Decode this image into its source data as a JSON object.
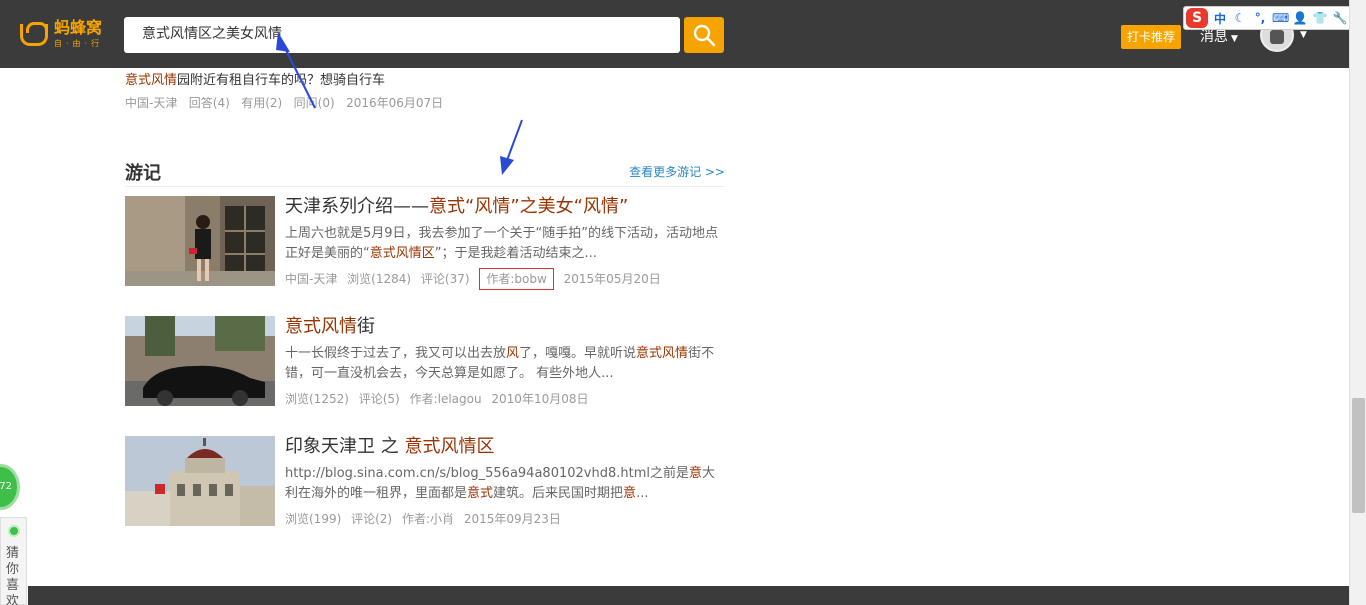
{
  "header": {
    "logo_text": "蚂蜂窝",
    "logo_sub": "自·由·行",
    "search_value": "意式风情区之美女风情",
    "checkin_label": "打卡推荐",
    "messages_label": "消息"
  },
  "ime": {
    "items": [
      "中",
      "☾",
      "°,",
      "⌨",
      "👤",
      "👕",
      "🔧"
    ]
  },
  "top_item": {
    "title_hl": "意式风情",
    "title_rest": "园附近有租自行车的吗？想骑自行车",
    "meta": "中国-天津   回答(4)   有用(2)   同问(0)   2016年06月07日"
  },
  "section": {
    "title": "游记",
    "more": "查看更多游记 >>"
  },
  "travels": [
    {
      "title_pre": "天津系列介绍——",
      "title_hl": "意式“风情”之美女“风情”",
      "desc_1": "上周六也就是5月9日，我去参加了一个关于“随手拍”的线下活动，活动地点正好是美丽的“",
      "desc_hl": "意式风情区",
      "desc_2": "”；于是我趁着活动结束之...",
      "location": "中国-天津",
      "views": "浏览(1284)",
      "comments": "评论(37)",
      "author": "作者:bobw",
      "date": "2015年05月20日"
    },
    {
      "title_hl": "意式风情",
      "title_post": "街",
      "desc_1": "十一长假终于过去了，我又可以出去放",
      "desc_hl": "风",
      "desc_2": "了，嘎嘎。早就听说",
      "desc_hl2": "意式风情",
      "desc_3": "街不错，可一直没机会去，今天总算是如愿了。 有些外地人...",
      "views": "浏览(1252)",
      "comments": "评论(5)",
      "author": "作者:lelagou",
      "date": "2010年10月08日"
    },
    {
      "title_pre": "印象天津卫 之 ",
      "title_hl": "意式风情区",
      "desc_1": "http://blog.sina.com.cn/s/blog_556a94a80102vhd8.html之前是",
      "desc_hl": "意",
      "desc_2": "大利在海外的唯一租界，里面都是",
      "desc_hl2": "意式",
      "desc_3": "建筑。后来民国时期把",
      "desc_hl3": "意",
      "desc_4": "...",
      "views": "浏览(199)",
      "comments": "评论(2)",
      "author": "作者:小肖",
      "date": "2015年09月23日"
    }
  ],
  "side": {
    "badge": "72",
    "guess_label": "猜你喜欢"
  },
  "colors": {
    "header_bg": "#3b3b3b",
    "accent": "#f7a400",
    "highlight": "#993300",
    "link": "#2a86c8"
  }
}
